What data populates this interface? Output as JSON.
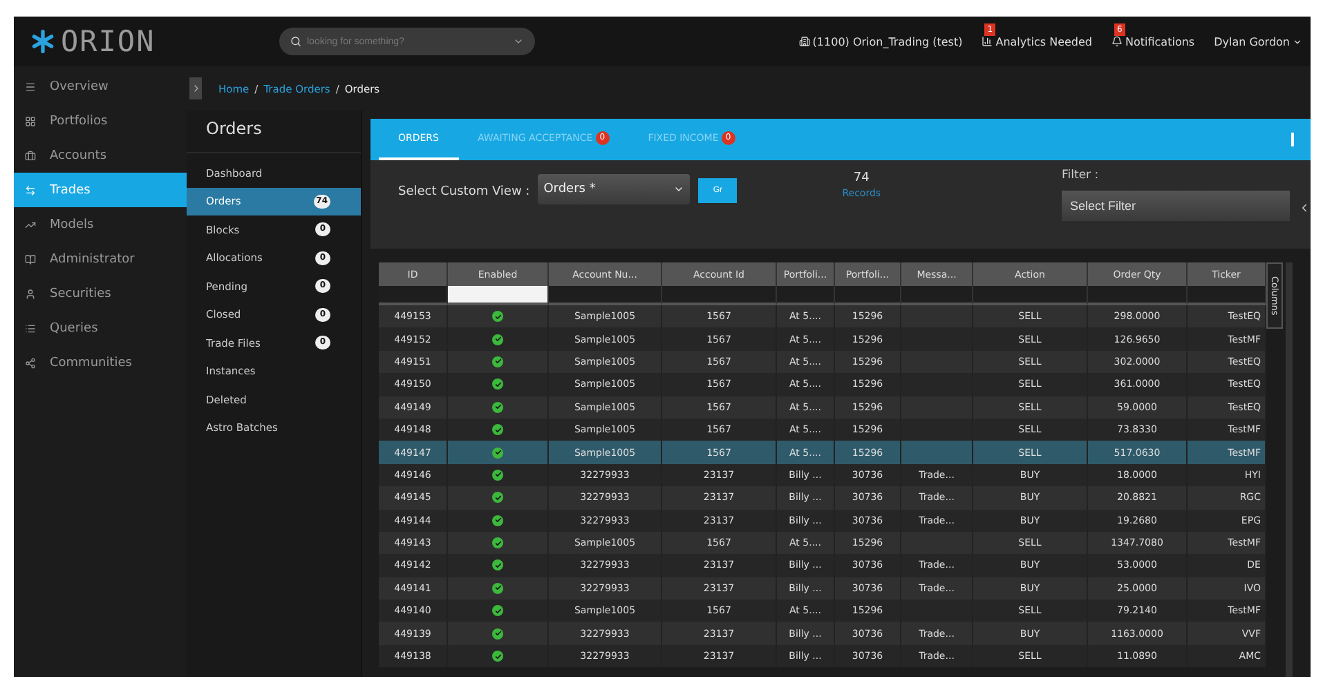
{
  "logo": "ORION",
  "search": {
    "placeholder": "looking for something?"
  },
  "topbar": {
    "firm": "(1100) Orion_Trading (test)",
    "alerts": [
      {
        "label": "Analytics Needed",
        "badge": "1"
      },
      {
        "label": "Notifications",
        "badge": "6"
      }
    ],
    "user": "Dylan Gordon"
  },
  "nav": [
    {
      "label": "Overview",
      "selected": false
    },
    {
      "label": "Portfolios",
      "selected": false
    },
    {
      "label": "Accounts",
      "selected": false
    },
    {
      "label": "Trades",
      "selected": true
    },
    {
      "label": "Models",
      "selected": false
    },
    {
      "label": "Administrator",
      "selected": false
    },
    {
      "label": "Securities",
      "selected": false
    },
    {
      "label": "Queries",
      "selected": false
    },
    {
      "label": "Communities",
      "selected": false
    }
  ],
  "breadcrumb": {
    "separator": "/",
    "items": [
      "Home",
      "Trade Orders",
      "Orders"
    ]
  },
  "subnav": {
    "title": "Orders",
    "items": [
      {
        "label": "Dashboard",
        "selected": false
      },
      {
        "label": "Orders",
        "count": "74",
        "selected": true
      },
      {
        "label": "Blocks",
        "count": "0",
        "selected": false
      },
      {
        "label": "Allocations",
        "count": "0",
        "selected": false
      },
      {
        "label": "Pending",
        "count": "0",
        "selected": false
      },
      {
        "label": "Closed",
        "count": "0",
        "selected": false
      },
      {
        "label": "Trade Files",
        "count": "0",
        "selected": false
      },
      {
        "label": "Instances",
        "selected": false
      },
      {
        "label": "Deleted",
        "selected": false
      },
      {
        "label": "Astro Batches",
        "selected": false
      }
    ]
  },
  "tabs": [
    {
      "label": "ORDERS",
      "selected": true
    },
    {
      "label": "AWAITING ACCEPTANCE",
      "badge": "0",
      "selected": false
    },
    {
      "label": "FIXED INCOME",
      "badge": "0",
      "selected": false
    }
  ],
  "toolbar": {
    "view_label": "Select Custom View :",
    "view_value": "Orders *",
    "go": "Gr",
    "records_count": "74",
    "records_label": "Records",
    "filter_label": "Filter :",
    "filter_placeholder": "Select Filter"
  },
  "table": {
    "columns": [
      "ID",
      "Enabled",
      "Account Nu...",
      "Account Id",
      "Portfoli...",
      "Portfoli...",
      "Messa...",
      "Action",
      "Order Qty",
      "Ticker"
    ],
    "side_tab": "Columns",
    "rows": [
      {
        "cells": [
          "449153",
          "",
          "Sample1005",
          "1567",
          "At 5....",
          "15296",
          "",
          "SELL",
          "298.0000",
          "TestEQ"
        ],
        "enabled": true,
        "selected": false
      },
      {
        "cells": [
          "449152",
          "",
          "Sample1005",
          "1567",
          "At 5....",
          "15296",
          "",
          "SELL",
          "126.9650",
          "TestMF"
        ],
        "enabled": true,
        "selected": false
      },
      {
        "cells": [
          "449151",
          "",
          "Sample1005",
          "1567",
          "At 5....",
          "15296",
          "",
          "SELL",
          "302.0000",
          "TestEQ"
        ],
        "enabled": true,
        "selected": false
      },
      {
        "cells": [
          "449150",
          "",
          "Sample1005",
          "1567",
          "At 5....",
          "15296",
          "",
          "SELL",
          "361.0000",
          "TestEQ"
        ],
        "enabled": true,
        "selected": false
      },
      {
        "cells": [
          "449149",
          "",
          "Sample1005",
          "1567",
          "At 5....",
          "15296",
          "",
          "SELL",
          "59.0000",
          "TestEQ"
        ],
        "enabled": true,
        "selected": false
      },
      {
        "cells": [
          "449148",
          "",
          "Sample1005",
          "1567",
          "At 5....",
          "15296",
          "",
          "SELL",
          "73.8330",
          "TestMF"
        ],
        "enabled": true,
        "selected": false
      },
      {
        "cells": [
          "449147",
          "",
          "Sample1005",
          "1567",
          "At 5....",
          "15296",
          "",
          "SELL",
          "517.0630",
          "TestMF"
        ],
        "enabled": true,
        "selected": true
      },
      {
        "cells": [
          "449146",
          "",
          "32279933",
          "23137",
          "Billy ...",
          "30736",
          "Trade...",
          "BUY",
          "18.0000",
          "HYI"
        ],
        "enabled": true,
        "selected": false
      },
      {
        "cells": [
          "449145",
          "",
          "32279933",
          "23137",
          "Billy ...",
          "30736",
          "Trade...",
          "BUY",
          "20.8821",
          "RGC"
        ],
        "enabled": true,
        "selected": false
      },
      {
        "cells": [
          "449144",
          "",
          "32279933",
          "23137",
          "Billy ...",
          "30736",
          "Trade...",
          "BUY",
          "19.2680",
          "EPG"
        ],
        "enabled": true,
        "selected": false
      },
      {
        "cells": [
          "449143",
          "",
          "Sample1005",
          "1567",
          "At 5....",
          "15296",
          "",
          "SELL",
          "1347.7080",
          "TestMF"
        ],
        "enabled": true,
        "selected": false
      },
      {
        "cells": [
          "449142",
          "",
          "32279933",
          "23137",
          "Billy ...",
          "30736",
          "Trade...",
          "BUY",
          "53.0000",
          "DE"
        ],
        "enabled": true,
        "selected": false
      },
      {
        "cells": [
          "449141",
          "",
          "32279933",
          "23137",
          "Billy ...",
          "30736",
          "Trade...",
          "BUY",
          "25.0000",
          "IVO"
        ],
        "enabled": true,
        "selected": false
      },
      {
        "cells": [
          "449140",
          "",
          "Sample1005",
          "1567",
          "At 5....",
          "15296",
          "",
          "SELL",
          "79.2140",
          "TestMF"
        ],
        "enabled": true,
        "selected": false
      },
      {
        "cells": [
          "449139",
          "",
          "32279933",
          "23137",
          "Billy ...",
          "30736",
          "Trade...",
          "BUY",
          "1163.0000",
          "VVF"
        ],
        "enabled": true,
        "selected": false
      },
      {
        "cells": [
          "449138",
          "",
          "32279933",
          "23137",
          "Billy ...",
          "30736",
          "Trade...",
          "SELL",
          "11.0890",
          "AMC"
        ],
        "enabled": true,
        "selected": false
      }
    ]
  }
}
